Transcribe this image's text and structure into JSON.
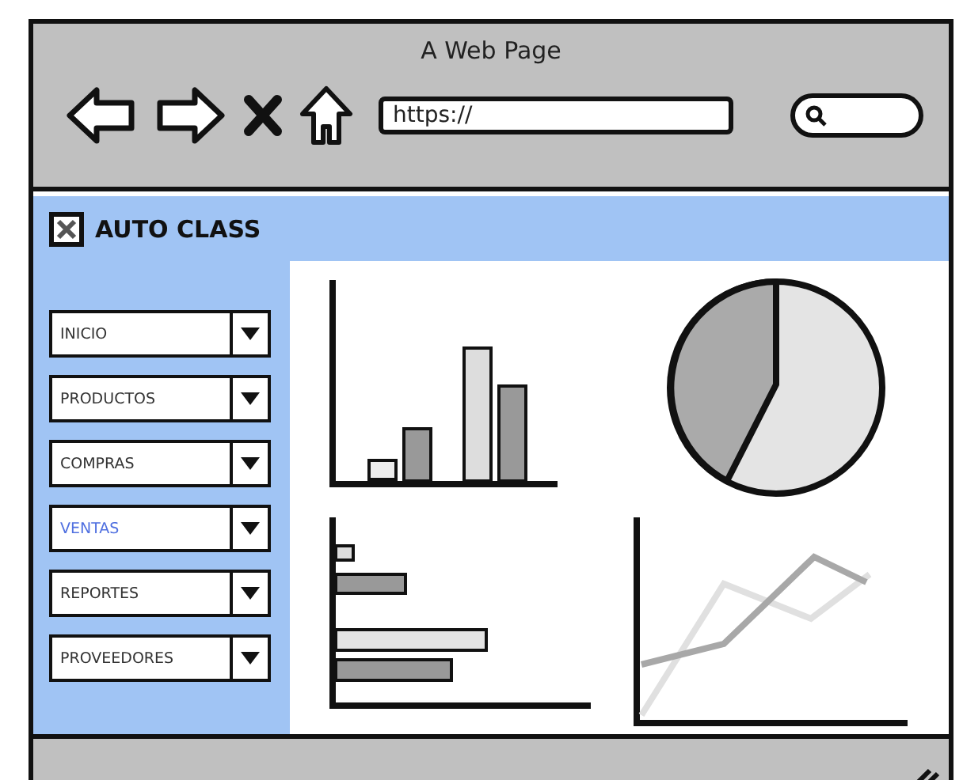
{
  "window": {
    "title": "A Web Page"
  },
  "address_bar": {
    "value": "https://"
  },
  "app_header": {
    "title": "AUTO CLASS"
  },
  "menu": [
    {
      "label": "INICIO",
      "selected": false
    },
    {
      "label": "PRODUCTOS",
      "selected": false
    },
    {
      "label": "COMPRAS",
      "selected": false
    },
    {
      "label": "VENTAS",
      "selected": true
    },
    {
      "label": "REPORTES",
      "selected": false
    },
    {
      "label": "PROVEEDORES",
      "selected": false
    }
  ]
}
